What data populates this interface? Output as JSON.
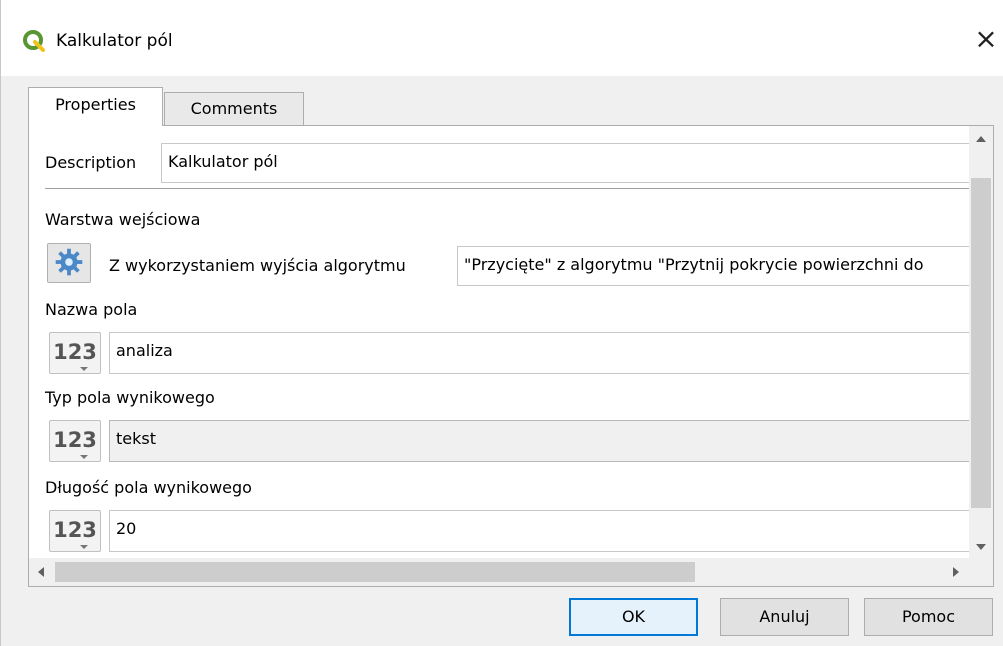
{
  "window": {
    "title": "Kalkulator pól",
    "close_label": "×"
  },
  "tabs": [
    {
      "label": "Properties",
      "active": true
    },
    {
      "label": "Comments",
      "active": false
    }
  ],
  "form": {
    "description_label": "Description",
    "description_value": "Kalkulator pól",
    "input_layer": {
      "label": "Warstwa wejściowa",
      "mode_label": "Z wykorzystaniem wyjścia algorytmu",
      "value": "\"Przycięte\" z algorytmu \"Przytnij pokrycie powierzchni do"
    },
    "field_name": {
      "label": "Nazwa pola",
      "button": "123",
      "value": "analiza"
    },
    "field_type": {
      "label": "Typ pola wynikowego",
      "button": "123",
      "value": "tekst"
    },
    "field_length": {
      "label": "Długość pola wynikowego",
      "button": "123",
      "value": "20"
    }
  },
  "buttons": {
    "ok": "OK",
    "cancel": "Anuluj",
    "help": "Pomoc"
  },
  "colors": {
    "qgis_green": "#589632",
    "default_button_border": "#0078d7",
    "algorithm_icon": "#4a88c8"
  },
  "icons": {
    "app": "qgis-logo-icon",
    "algorithm": "gear-algorithm-icon",
    "number_source": "number-123-icon"
  }
}
